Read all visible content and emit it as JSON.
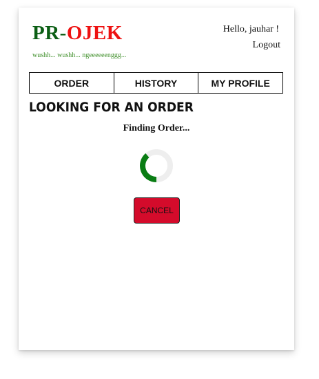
{
  "header": {
    "brand_left": "PR",
    "brand_sep": "-",
    "brand_right": "OJEK",
    "tagline": "wushh... wushh... ngeeeeeenggg...",
    "greeting": "Hello, jauhar !",
    "logout_label": "Logout"
  },
  "nav": {
    "items": [
      {
        "label": "ORDER"
      },
      {
        "label": "HISTORY"
      },
      {
        "label": "MY PROFILE"
      }
    ]
  },
  "main": {
    "title": "LOOKING FOR AN ORDER",
    "status": "Finding Order...",
    "cancel_label": "CANCEL"
  },
  "colors": {
    "brand_green": "#0b5e14",
    "brand_red": "#ee1111",
    "spinner_track": "#eeeeee",
    "spinner_arc": "#0a7d14",
    "cancel_bg": "#d40b2b"
  },
  "icons": {
    "spinner": "loading-spinner-icon"
  }
}
